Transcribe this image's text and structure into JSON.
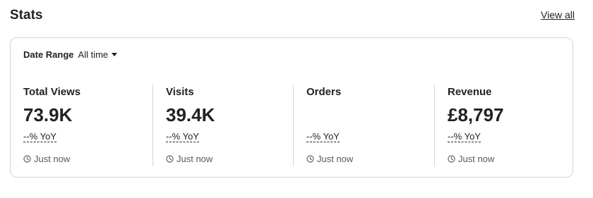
{
  "header": {
    "title": "Stats",
    "view_all_label": "View all"
  },
  "date_range": {
    "label": "Date Range",
    "selected": "All time"
  },
  "metrics": [
    {
      "label": "Total Views",
      "value": "73.9K",
      "yoy": "--% YoY",
      "updated": "Just now"
    },
    {
      "label": "Visits",
      "value": "39.4K",
      "yoy": "--% YoY",
      "updated": "Just now"
    },
    {
      "label": "Orders",
      "value": "",
      "yoy": "--% YoY",
      "updated": "Just now"
    },
    {
      "label": "Revenue",
      "value": "£8,797",
      "yoy": "--% YoY",
      "updated": "Just now"
    }
  ],
  "icons": {
    "caret": "chevron-down-icon",
    "updated": "clock-icon"
  },
  "colors": {
    "text": "#222222",
    "muted": "#595959",
    "border": "#d6d6d6"
  }
}
